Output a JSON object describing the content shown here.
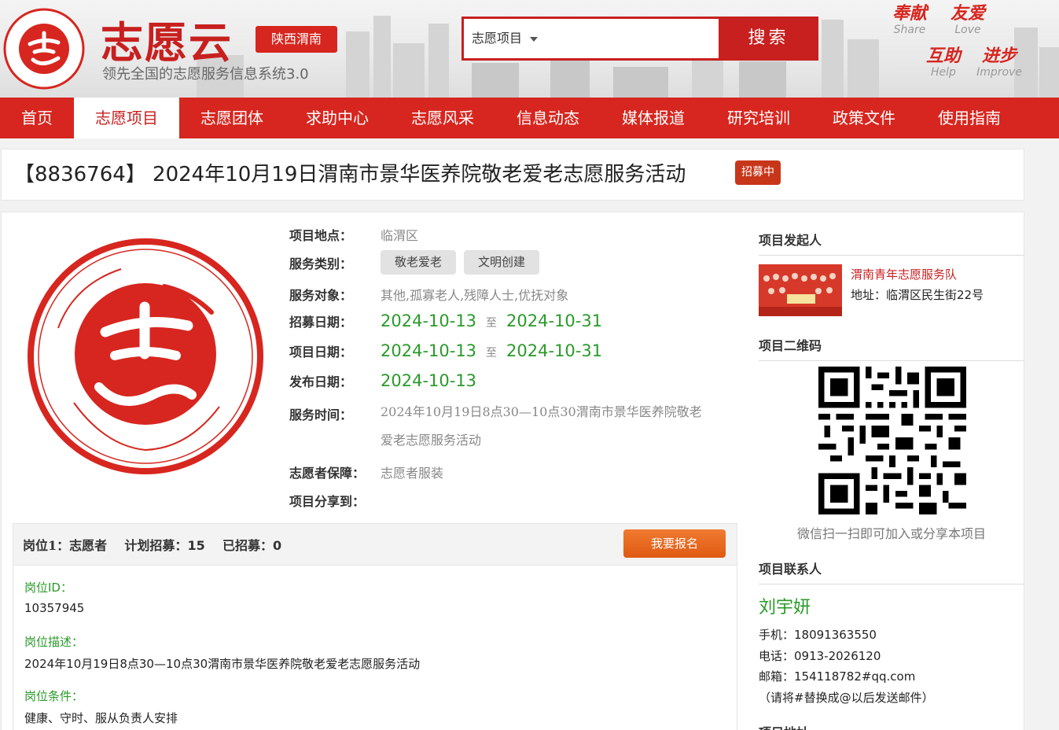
{
  "header": {
    "brand": "志愿云",
    "region": "陕西渭南",
    "slogan": "领先全国的志愿服务信息系统3.0",
    "search_select": "志愿项目",
    "search_button": "搜索",
    "mottos": [
      {
        "cn": "奉献",
        "en": "Share"
      },
      {
        "cn": "友爱",
        "en": "Love"
      },
      {
        "cn": "互助",
        "en": "Help"
      },
      {
        "cn": "进步",
        "en": "Improve"
      }
    ]
  },
  "nav": {
    "items": [
      "首页",
      "志愿项目",
      "志愿团体",
      "求助中心",
      "志愿风采",
      "信息动态",
      "媒体报道",
      "研究培训",
      "政策文件",
      "使用指南"
    ],
    "active": "志愿项目"
  },
  "project": {
    "title": "【8836764】 2024年10月19日渭南市景华医养院敬老爱老志愿服务活动",
    "status": "招募中",
    "location_label": "项目地点：",
    "location": "临渭区",
    "category_label": "服务类别：",
    "categories": [
      "敬老爱老",
      "文明创建"
    ],
    "target_label": "服务对象：",
    "target": "其他,孤寡老人,残障人士,优抚对象",
    "recruit_label": "招募日期：",
    "recruit_start": "2024-10-13",
    "recruit_end": "2024-10-31",
    "project_label": "项目日期：",
    "project_start": "2024-10-13",
    "project_end": "2024-10-31",
    "publish_label": "发布日期：",
    "publish": "2024-10-13",
    "range_sep": "至",
    "time_label": "服务时间：",
    "time_line1": "2024年10月19日8点30—10点30渭南市景华医养院敬老",
    "time_line2": "爱老志愿服务活动",
    "guarantee_label": "志愿者保障：",
    "guarantee": "志愿者服装",
    "share_label": "项目分享到："
  },
  "position": {
    "title_prefix": "岗位1：志愿者",
    "plan_label": "计划招募：",
    "plan": "15",
    "recruited_label": "已招募：",
    "recruited": "0",
    "signup_button": "我要报名",
    "id_label": "岗位ID：",
    "id": "10357945",
    "desc_label": "岗位描述：",
    "desc": "2024年10月19日8点30—10点30渭南市景华医养院敬老爱老志愿服务活动",
    "cond_label": "岗位条件：",
    "cond": "健康、守时、服从负责人安排"
  },
  "sidebar": {
    "initiator_heading": "项目发起人",
    "team_name": "渭南青年志愿服务队",
    "team_address": "地址：临渭区民生街22号",
    "qr_heading": "项目二维码",
    "qr_caption": "微信扫一扫即可加入或分享本项目",
    "contact_heading": "项目联系人",
    "contact_name": "刘宇妍",
    "mobile": "手机：18091363550",
    "phone": "电话：0913-2026120",
    "email": "邮箱：154118782#qq.com",
    "email_note": "（请将#替换成@以后发送邮件）",
    "next_heading": "项目地址"
  },
  "colors": {
    "brand_red": "#d7261f",
    "status_green": "#2a9a2a",
    "signup_orange": "#e86a20"
  }
}
